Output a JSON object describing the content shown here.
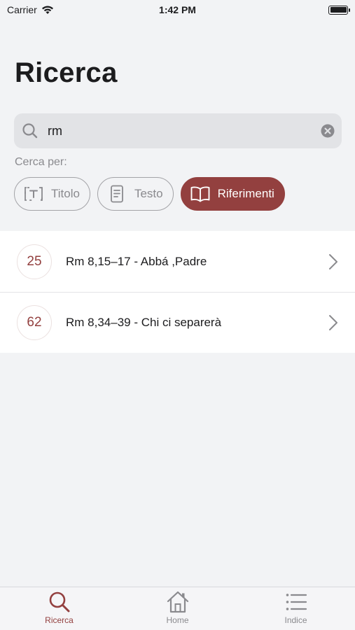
{
  "status_bar": {
    "carrier": "Carrier",
    "time": "1:42 PM"
  },
  "page": {
    "title": "Ricerca"
  },
  "search": {
    "value": "rm",
    "placeholder": ""
  },
  "filter": {
    "label": "Cerca per:",
    "chips": [
      {
        "label": "Titolo",
        "icon": "title-icon",
        "active": false
      },
      {
        "label": "Testo",
        "icon": "document-icon",
        "active": false
      },
      {
        "label": "Riferimenti",
        "icon": "book-icon",
        "active": true
      }
    ]
  },
  "results": [
    {
      "number": "25",
      "text": "Rm 8,15–17 - Abbá ,Padre"
    },
    {
      "number": "62",
      "text": "Rm 8,34–39 - Chi ci separerà"
    }
  ],
  "tabs": [
    {
      "label": "Ricerca",
      "icon": "search-icon",
      "active": true
    },
    {
      "label": "Home",
      "icon": "home-icon",
      "active": false
    },
    {
      "label": "Indice",
      "icon": "list-icon",
      "active": false
    }
  ],
  "colors": {
    "accent": "#93403f",
    "background": "#f2f3f5",
    "inactive": "#8a8a8e"
  }
}
